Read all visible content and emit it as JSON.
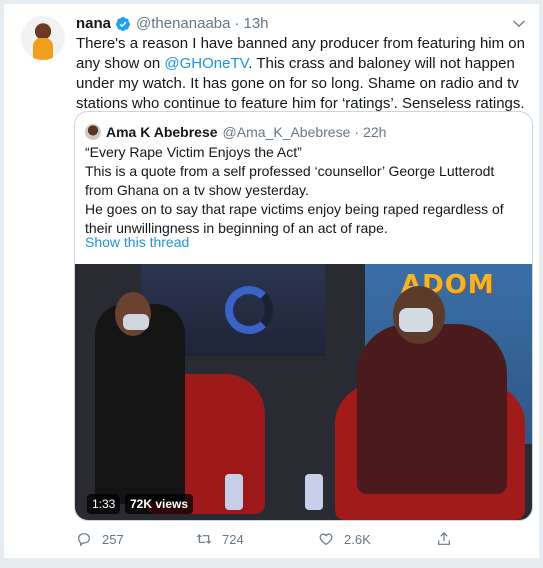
{
  "tweet": {
    "author_name": "nana",
    "author_handle": "@thenanaaba",
    "separator": "·",
    "time": "13h",
    "text_pre": "There's a reason I have banned any producer from featuring him on any show on ",
    "mention": "@GHOneTV",
    "text_post": ". This crass and baloney will not happen under my watch. It has gone on for so long. Shame on radio and tv stations who continue to feature him for ‘ratings’. Senseless ratings.",
    "icons": {
      "verified": "verified-badge-icon",
      "caret": "chevron-down-icon"
    },
    "colors": {
      "link": "#1b95e0",
      "secondary_text": "#657786",
      "verified": "#1da1f2"
    }
  },
  "quote": {
    "author_name": "Ama K Abebrese",
    "author_handle": "@Ama_K_Abebrese",
    "separator": "·",
    "time": "22h",
    "lines": [
      "“Every Rape Victim Enjoys the Act”",
      "This is a quote from a self professed ‘counsellor’ George Lutterodt from Ghana on a tv show yesterday.",
      "He goes on to say that rape victims enjoy being raped regardless of their unwillingness in beginning of an act of rape."
    ],
    "show_thread": "Show this thread",
    "video": {
      "duration": "1:33",
      "views": "72K views",
      "logo": "ADOM"
    }
  },
  "actions": {
    "reply_count": "257",
    "retweet_count": "724",
    "like_count": "2.6K",
    "icons": [
      "reply-icon",
      "retweet-icon",
      "like-icon",
      "share-icon"
    ]
  }
}
